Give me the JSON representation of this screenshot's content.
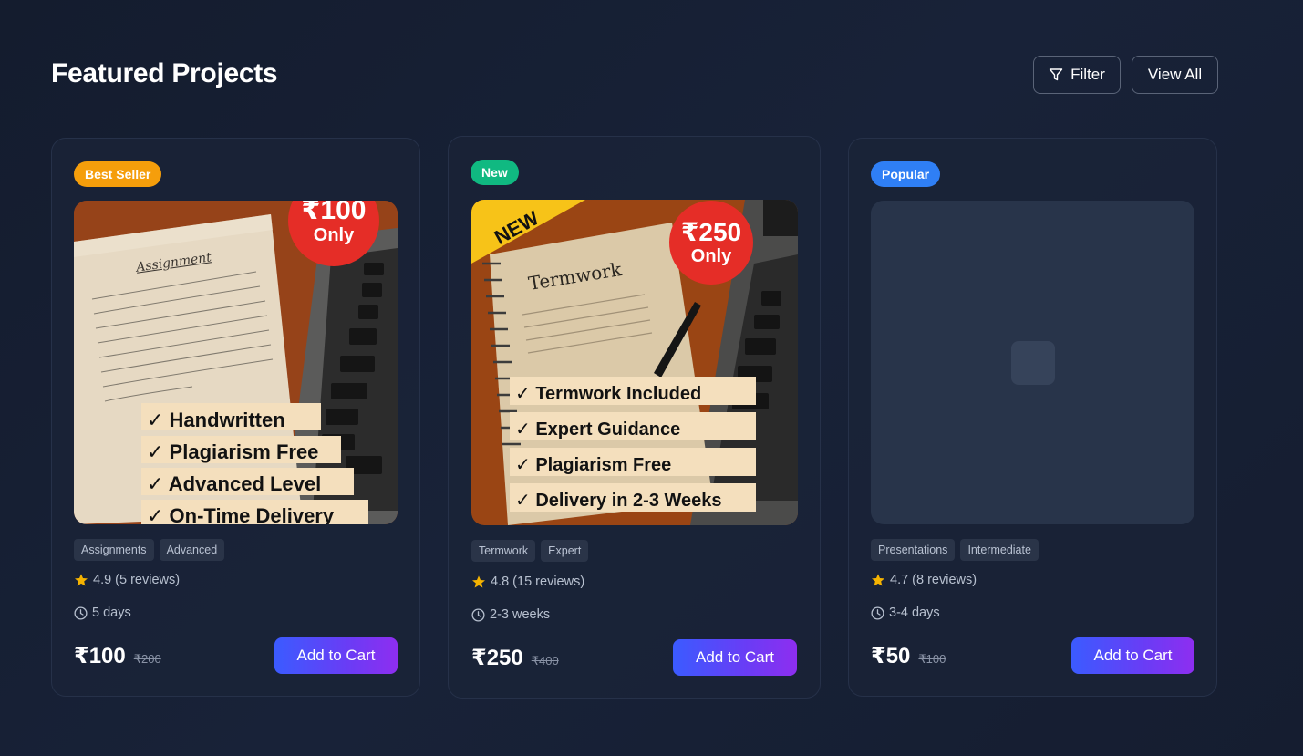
{
  "header": {
    "title": "Featured Projects",
    "filter_label": "Filter",
    "view_all_label": "View All"
  },
  "colors": {
    "best_seller_badge": "#f59e0b",
    "new_badge": "#10b981",
    "popular_badge": "#2f7ff5",
    "star": "#f5b301",
    "cta_gradient_start": "#3b5bff",
    "cta_gradient_end": "#8e2ef0"
  },
  "products": [
    {
      "badge": "Best Seller",
      "image": {
        "price_circle": "₹100",
        "price_circle_sub": "Only",
        "paper_title": "Assignment",
        "checklist": [
          "Handwritten",
          "Plagiarism Free",
          "Advanced Level",
          "On-Time Delivery"
        ]
      },
      "tags": [
        "Assignments",
        "Advanced"
      ],
      "rating": "4.9 (5 reviews)",
      "duration": "5 days",
      "price": "₹100",
      "old_price": "₹200",
      "cta": "Add to Cart"
    },
    {
      "badge": "New",
      "image": {
        "corner_ribbon": "NEW",
        "price_circle": "₹250",
        "price_circle_sub": "Only",
        "paper_title": "Termwork",
        "checklist": [
          "Termwork Included",
          "Expert Guidance",
          "Plagiarism Free",
          "Delivery in 2-3 Weeks"
        ]
      },
      "tags": [
        "Termwork",
        "Expert"
      ],
      "rating": "4.8 (15 reviews)",
      "duration": "2-3 weeks",
      "price": "₹250",
      "old_price": "₹400",
      "cta": "Add to Cart"
    },
    {
      "badge": "Popular",
      "image": {
        "placeholder": "image-placeholder-icon"
      },
      "tags": [
        "Presentations",
        "Intermediate"
      ],
      "rating": "4.7 (8 reviews)",
      "duration": "3-4 days",
      "price": "₹50",
      "old_price": "₹100",
      "cta": "Add to Cart"
    }
  ]
}
